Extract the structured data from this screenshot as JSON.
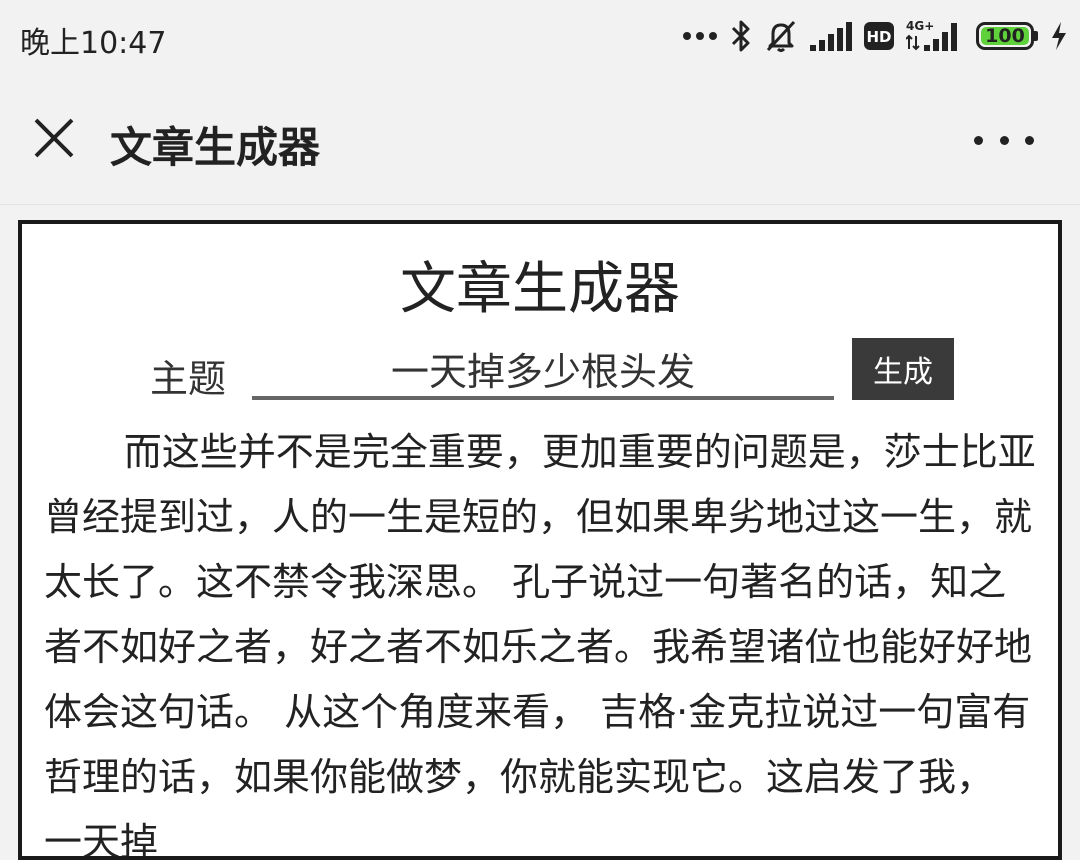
{
  "status_bar": {
    "time": "晚上10:47",
    "battery": "100",
    "icons": [
      "more-dots-icon",
      "bluetooth-icon",
      "mute-bell-icon",
      "signal-icon",
      "hd-icon",
      "4g-signal-icon",
      "battery-icon",
      "charging-icon"
    ],
    "battery_color": "#5fd13a"
  },
  "titlebar": {
    "title": "文章生成器"
  },
  "page": {
    "heading": "文章生成器",
    "topic_label": "主题",
    "topic_value": "一天掉多少根头发",
    "generate_label": "生成",
    "article": "而这些并不是完全重要，更加重要的问题是，莎士比亚曾经提到过，人的一生是短的，但如果卑劣地过这一生，就太长了。这不禁令我深思。 孔子说过一句著名的话，知之者不如好之者，好之者不如乐之者。我希望诸位也能好好地体会这句话。 从这个角度来看， 吉格·金克拉说过一句富有哲理的话，如果你能做梦，你就能实现它。这启发了我， 一天掉"
  }
}
